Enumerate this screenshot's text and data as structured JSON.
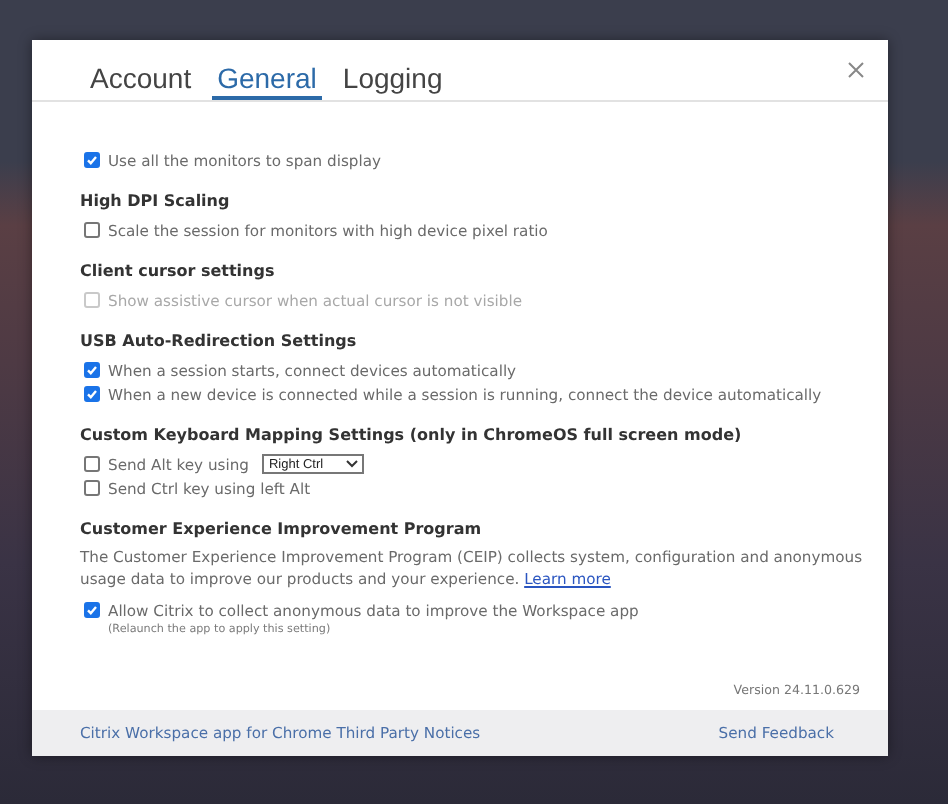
{
  "tabs": [
    {
      "label": "Account",
      "selected": false
    },
    {
      "label": "General",
      "selected": true
    },
    {
      "label": "Logging",
      "selected": false
    }
  ],
  "sections": [
    {
      "items": [
        {
          "kind": "checkbox",
          "label": "Use all the monitors to span display",
          "checked": true,
          "disabled": false
        }
      ]
    },
    {
      "heading": "High DPI Scaling",
      "items": [
        {
          "kind": "checkbox",
          "label": "Scale the session for monitors with high device pixel ratio",
          "checked": false,
          "disabled": false
        }
      ]
    },
    {
      "heading": "Client cursor settings",
      "items": [
        {
          "kind": "checkbox",
          "label": "Show assistive cursor when actual cursor is not visible",
          "checked": false,
          "disabled": true
        }
      ]
    },
    {
      "heading": "USB Auto-Redirection Settings",
      "items": [
        {
          "kind": "checkbox",
          "label": "When a session starts, connect devices automatically",
          "checked": true,
          "disabled": false
        },
        {
          "kind": "checkbox",
          "label": "When a new device is connected while a session is running, connect the device automatically",
          "checked": true,
          "disabled": false
        }
      ]
    },
    {
      "heading": "Custom Keyboard Mapping Settings (only in ChromeOS full screen mode)",
      "items": [
        {
          "kind": "select",
          "label": "Send Alt key using",
          "checked": false,
          "disabled": false,
          "value": "Right Ctrl"
        },
        {
          "kind": "checkbox",
          "label": "Send Ctrl key using left Alt",
          "checked": false,
          "disabled": false
        }
      ]
    },
    {
      "heading": "Customer Experience Improvement Program",
      "description": "The Customer Experience Improvement Program (CEIP) collects system, configuration and anonymous usage data to improve our products and your experience.",
      "link": "Learn more",
      "items": [
        {
          "kind": "checkbox",
          "label": "Allow Citrix to collect anonymous data to improve the Workspace app",
          "checked": true,
          "disabled": false,
          "note": "(Relaunch the app to apply this setting)"
        }
      ]
    }
  ],
  "version": "Version 24.11.0.629",
  "footer": {
    "notices": "Citrix Workspace app for Chrome Third Party Notices",
    "feedback": "Send Feedback"
  }
}
